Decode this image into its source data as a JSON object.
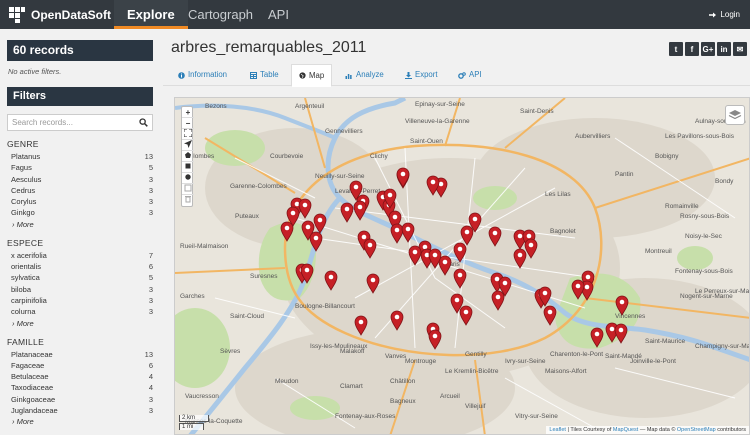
{
  "nav": {
    "brand": "OpenDataSoft",
    "tabs": [
      "Explore",
      "Cartograph",
      "API"
    ],
    "login": "Login"
  },
  "sidebar": {
    "records": "60 records",
    "no_filters": "No active filters.",
    "filters_title": "Filters",
    "search_placeholder": "Search records...",
    "more_label": "› More",
    "facets": [
      {
        "title": "GENRE",
        "items": [
          {
            "label": "Platanus",
            "count": "13"
          },
          {
            "label": "Fagus",
            "count": "5"
          },
          {
            "label": "Aesculus",
            "count": "3"
          },
          {
            "label": "Cedrus",
            "count": "3"
          },
          {
            "label": "Corylus",
            "count": "3"
          },
          {
            "label": "Ginkgo",
            "count": "3"
          }
        ]
      },
      {
        "title": "ESPECE",
        "items": [
          {
            "label": "x acerifolia",
            "count": "7"
          },
          {
            "label": "orientalis",
            "count": "6"
          },
          {
            "label": "sylvatica",
            "count": "5"
          },
          {
            "label": "biloba",
            "count": "3"
          },
          {
            "label": "carpinifolia",
            "count": "3"
          },
          {
            "label": "colurna",
            "count": "3"
          }
        ]
      },
      {
        "title": "FAMILLE",
        "items": [
          {
            "label": "Platanaceae",
            "count": "13"
          },
          {
            "label": "Fagaceae",
            "count": "6"
          },
          {
            "label": "Betulaceae",
            "count": "4"
          },
          {
            "label": "Taxodiaceae",
            "count": "4"
          },
          {
            "label": "Ginkgoaceae",
            "count": "3"
          },
          {
            "label": "Juglandaceae",
            "count": "3"
          }
        ]
      }
    ]
  },
  "main": {
    "title": "arbres_remarquables_2011",
    "tabs": [
      "Information",
      "Table",
      "Map",
      "Analyze",
      "Export",
      "API"
    ],
    "share": [
      "t",
      "f",
      "G+",
      "in",
      "✉"
    ]
  },
  "map": {
    "zoom_in": "+",
    "zoom_out": "−",
    "scale_km": "2 km",
    "scale_mi": "1 mi",
    "attribution_leaflet": "Leaflet",
    "attribution_rest": " | Tiles Courtesy of ",
    "attribution_mapquest": "MapQuest",
    "attribution_data": " — Map data © ",
    "attribution_osm": "OpenStreetMap",
    "attribution_end": " contributors",
    "place_labels": [
      "Bezons",
      "Argenteuil",
      "Epinay-sur-Seine",
      "Saint-Denis",
      "Aubervilliers",
      "Aulnay-sous-Bois",
      "Garenne-Colombes",
      "Courbevoie",
      "Clichy",
      "Saint-Ouen",
      "Pantin",
      "Bobigny",
      "Bondy",
      "Puteaux",
      "Neuilly-sur-Seine",
      "Levallois-Perret",
      "Les Lilas",
      "Bagnolet",
      "Romainville",
      "Rosny-sous-Bois",
      "Montreuil",
      "Fontenay-sous-Bois",
      "Vincennes",
      "Saint-Mandé",
      "Nogent-sur-Marne",
      "Joinville-le-Pont",
      "Boulogne-Billancourt",
      "Issy-les-Moulineaux",
      "Vanves",
      "Malakoff",
      "Montrouge",
      "Gentilly",
      "Le Kremlin-Bicêtre",
      "Ivry-sur-Seine",
      "Vitry-sur-Seine",
      "Charenton-le-Pont",
      "Saint-Maurice",
      "Saint-Cloud",
      "Sèvres",
      "Meudon",
      "Clamart",
      "Châtillon",
      "Champigny-sur-Marne",
      "Le Perreux-sur-Marne",
      "Garches",
      "Suresnes",
      "Rueil-Malmaison",
      "Paris",
      "Colombes",
      "Gennevilliers",
      "Villeneuve-la-Garenne",
      "Noisy-le-Sec",
      "Les Pavillons-sous-Bois",
      "Maisons-Alfort",
      "Arcueil",
      "Villejuif",
      "Bagneux",
      "Fontenay-aux-Roses",
      "Vaucresson",
      "Marnes-la-Coquette"
    ]
  }
}
